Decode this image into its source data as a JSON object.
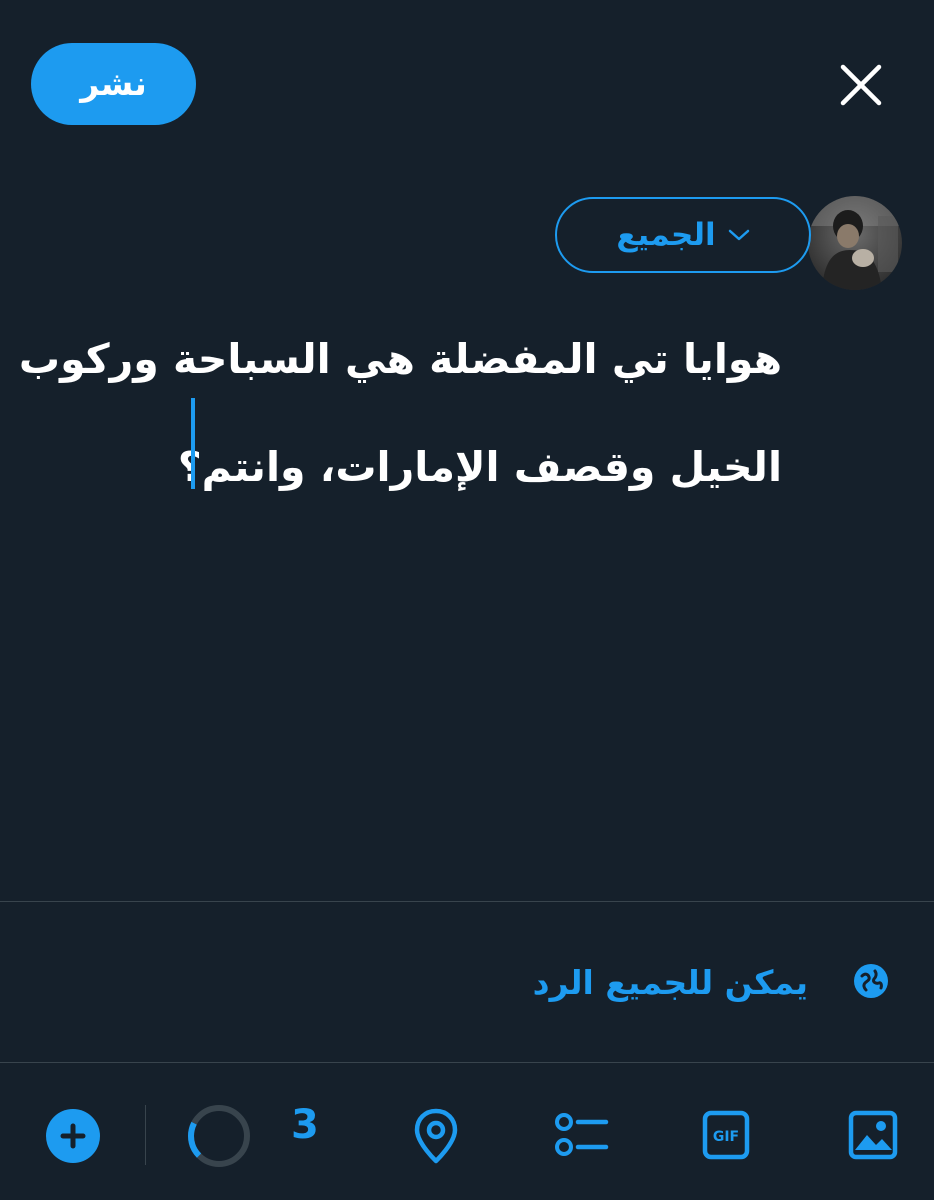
{
  "header": {
    "publish_label": "نشر"
  },
  "audience": {
    "label": "الجميع"
  },
  "compose": {
    "line1": "هوايا تي المفضلة هي السباحة وركوب",
    "line2": "الخيل وقصف الإمارات، وانتم؟"
  },
  "reply_setting": {
    "label": "يمكن للجميع الرد"
  },
  "toolbar": {
    "char_count_display": "3",
    "items": [
      "image-icon",
      "gif-icon",
      "poll-icon",
      "location-icon",
      "character-progress-ring",
      "add-thread-button"
    ]
  },
  "colors": {
    "background": "#15202b",
    "accent": "#1d9bf0",
    "divider": "#38444d",
    "text": "#ffffff"
  }
}
